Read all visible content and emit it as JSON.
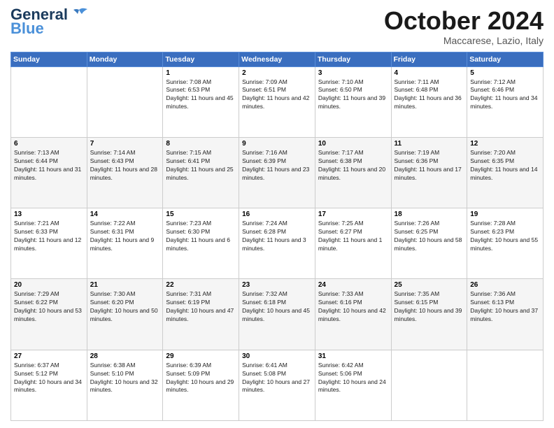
{
  "header": {
    "logo_line1": "General",
    "logo_line2": "Blue",
    "month_title": "October 2024",
    "location": "Maccarese, Lazio, Italy"
  },
  "weekdays": [
    "Sunday",
    "Monday",
    "Tuesday",
    "Wednesday",
    "Thursday",
    "Friday",
    "Saturday"
  ],
  "weeks": [
    [
      {
        "day": "",
        "info": ""
      },
      {
        "day": "",
        "info": ""
      },
      {
        "day": "1",
        "info": "Sunrise: 7:08 AM\nSunset: 6:53 PM\nDaylight: 11 hours and 45 minutes."
      },
      {
        "day": "2",
        "info": "Sunrise: 7:09 AM\nSunset: 6:51 PM\nDaylight: 11 hours and 42 minutes."
      },
      {
        "day": "3",
        "info": "Sunrise: 7:10 AM\nSunset: 6:50 PM\nDaylight: 11 hours and 39 minutes."
      },
      {
        "day": "4",
        "info": "Sunrise: 7:11 AM\nSunset: 6:48 PM\nDaylight: 11 hours and 36 minutes."
      },
      {
        "day": "5",
        "info": "Sunrise: 7:12 AM\nSunset: 6:46 PM\nDaylight: 11 hours and 34 minutes."
      }
    ],
    [
      {
        "day": "6",
        "info": "Sunrise: 7:13 AM\nSunset: 6:44 PM\nDaylight: 11 hours and 31 minutes."
      },
      {
        "day": "7",
        "info": "Sunrise: 7:14 AM\nSunset: 6:43 PM\nDaylight: 11 hours and 28 minutes."
      },
      {
        "day": "8",
        "info": "Sunrise: 7:15 AM\nSunset: 6:41 PM\nDaylight: 11 hours and 25 minutes."
      },
      {
        "day": "9",
        "info": "Sunrise: 7:16 AM\nSunset: 6:39 PM\nDaylight: 11 hours and 23 minutes."
      },
      {
        "day": "10",
        "info": "Sunrise: 7:17 AM\nSunset: 6:38 PM\nDaylight: 11 hours and 20 minutes."
      },
      {
        "day": "11",
        "info": "Sunrise: 7:19 AM\nSunset: 6:36 PM\nDaylight: 11 hours and 17 minutes."
      },
      {
        "day": "12",
        "info": "Sunrise: 7:20 AM\nSunset: 6:35 PM\nDaylight: 11 hours and 14 minutes."
      }
    ],
    [
      {
        "day": "13",
        "info": "Sunrise: 7:21 AM\nSunset: 6:33 PM\nDaylight: 11 hours and 12 minutes."
      },
      {
        "day": "14",
        "info": "Sunrise: 7:22 AM\nSunset: 6:31 PM\nDaylight: 11 hours and 9 minutes."
      },
      {
        "day": "15",
        "info": "Sunrise: 7:23 AM\nSunset: 6:30 PM\nDaylight: 11 hours and 6 minutes."
      },
      {
        "day": "16",
        "info": "Sunrise: 7:24 AM\nSunset: 6:28 PM\nDaylight: 11 hours and 3 minutes."
      },
      {
        "day": "17",
        "info": "Sunrise: 7:25 AM\nSunset: 6:27 PM\nDaylight: 11 hours and 1 minute."
      },
      {
        "day": "18",
        "info": "Sunrise: 7:26 AM\nSunset: 6:25 PM\nDaylight: 10 hours and 58 minutes."
      },
      {
        "day": "19",
        "info": "Sunrise: 7:28 AM\nSunset: 6:23 PM\nDaylight: 10 hours and 55 minutes."
      }
    ],
    [
      {
        "day": "20",
        "info": "Sunrise: 7:29 AM\nSunset: 6:22 PM\nDaylight: 10 hours and 53 minutes."
      },
      {
        "day": "21",
        "info": "Sunrise: 7:30 AM\nSunset: 6:20 PM\nDaylight: 10 hours and 50 minutes."
      },
      {
        "day": "22",
        "info": "Sunrise: 7:31 AM\nSunset: 6:19 PM\nDaylight: 10 hours and 47 minutes."
      },
      {
        "day": "23",
        "info": "Sunrise: 7:32 AM\nSunset: 6:18 PM\nDaylight: 10 hours and 45 minutes."
      },
      {
        "day": "24",
        "info": "Sunrise: 7:33 AM\nSunset: 6:16 PM\nDaylight: 10 hours and 42 minutes."
      },
      {
        "day": "25",
        "info": "Sunrise: 7:35 AM\nSunset: 6:15 PM\nDaylight: 10 hours and 39 minutes."
      },
      {
        "day": "26",
        "info": "Sunrise: 7:36 AM\nSunset: 6:13 PM\nDaylight: 10 hours and 37 minutes."
      }
    ],
    [
      {
        "day": "27",
        "info": "Sunrise: 6:37 AM\nSunset: 5:12 PM\nDaylight: 10 hours and 34 minutes."
      },
      {
        "day": "28",
        "info": "Sunrise: 6:38 AM\nSunset: 5:10 PM\nDaylight: 10 hours and 32 minutes."
      },
      {
        "day": "29",
        "info": "Sunrise: 6:39 AM\nSunset: 5:09 PM\nDaylight: 10 hours and 29 minutes."
      },
      {
        "day": "30",
        "info": "Sunrise: 6:41 AM\nSunset: 5:08 PM\nDaylight: 10 hours and 27 minutes."
      },
      {
        "day": "31",
        "info": "Sunrise: 6:42 AM\nSunset: 5:06 PM\nDaylight: 10 hours and 24 minutes."
      },
      {
        "day": "",
        "info": ""
      },
      {
        "day": "",
        "info": ""
      }
    ]
  ]
}
